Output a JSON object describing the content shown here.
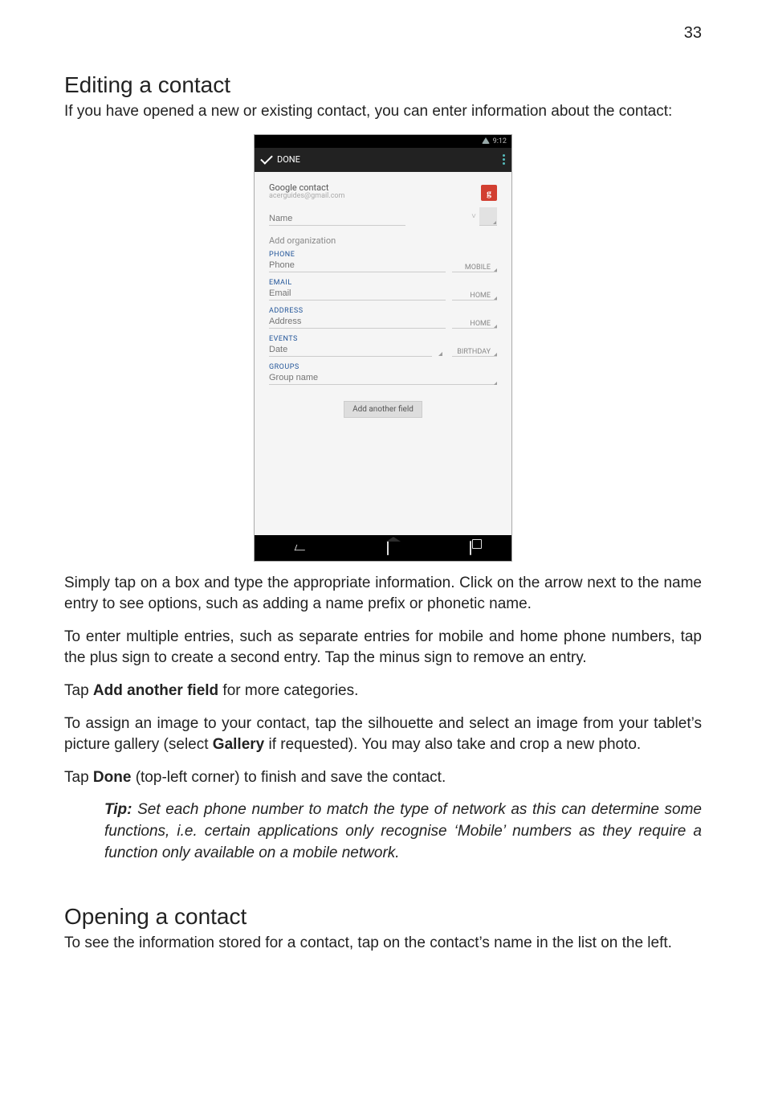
{
  "page_number": "33",
  "sections": {
    "editing": {
      "heading": "Editing a contact",
      "intro": "If you have opened a new or existing contact, you can enter information about the contact:",
      "after_shot_p1": "Simply tap on a box and type the appropriate information. Click on the arrow next to the name entry to see options, such as adding a name prefix or phonetic name.",
      "after_shot_p2": "To enter multiple entries, such as separate entries for mobile and home phone numbers, tap the plus sign to create a second entry. Tap the minus sign to remove an entry.",
      "after_shot_p3_pre": "Tap ",
      "after_shot_p3_bold": "Add another field",
      "after_shot_p3_post": " for more categories.",
      "after_shot_p4_pre": "To assign an image to your contact, tap the silhouette and select an image from your tablet’s picture gallery (select ",
      "after_shot_p4_bold": "Gallery",
      "after_shot_p4_post": " if requested). You may also take and crop a new photo.",
      "after_shot_p5_pre": "Tap ",
      "after_shot_p5_bold": "Done",
      "after_shot_p5_post": " (top-left corner) to finish and save the contact.",
      "tip_label": "Tip:",
      "tip_body": " Set each phone number to match the type of network as this can determine some functions, i.e. certain applications only recognise ‘Mobile’ numbers as they require a function only available on a mobile network."
    },
    "opening": {
      "heading": "Opening a contact",
      "body": "To see the information stored for a contact, tap on the contact’s name in the list on the left."
    }
  },
  "screenshot": {
    "status_time": "9:12",
    "action_done": "DONE",
    "account_type": "Google contact",
    "account_email": "acerguides@gmail.com",
    "google_badge": "g",
    "name_placeholder": "Name",
    "add_org": "Add organization",
    "sections": {
      "phone": "PHONE",
      "email": "EMAIL",
      "address": "ADDRESS",
      "events": "EVENTS",
      "groups": "GROUPS"
    },
    "fields": {
      "phone_placeholder": "Phone",
      "phone_type": "MOBILE",
      "email_placeholder": "Email",
      "email_type": "HOME",
      "address_placeholder": "Address",
      "address_type": "HOME",
      "date_placeholder": "Date",
      "date_type": "BIRTHDAY",
      "group_placeholder": "Group name"
    },
    "add_another": "Add another field"
  }
}
